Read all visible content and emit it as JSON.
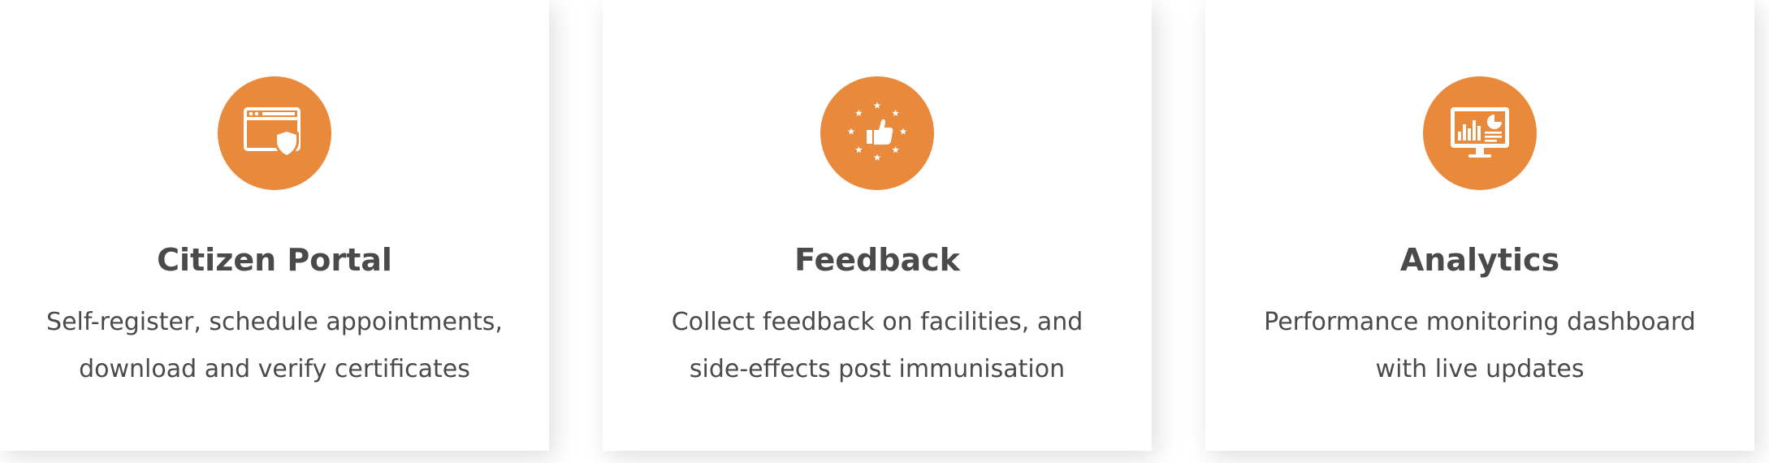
{
  "colors": {
    "accent": "#E8893B",
    "text": "#4A4A4A",
    "card_background": "#FFFFFF"
  },
  "features": [
    {
      "icon": "browser-shield-icon",
      "title": "Citizen Portal",
      "lines": [
        "Self-register, schedule appointments,",
        "download and verify certificates"
      ]
    },
    {
      "icon": "thumbs-up-stars-icon",
      "title": "Feedback",
      "lines": [
        "Collect feedback on facilities, and",
        "side-effects post immunisation"
      ]
    },
    {
      "icon": "monitor-dashboard-icon",
      "title": "Analytics",
      "lines": [
        "Performance monitoring dashboard",
        "with live updates"
      ]
    }
  ]
}
